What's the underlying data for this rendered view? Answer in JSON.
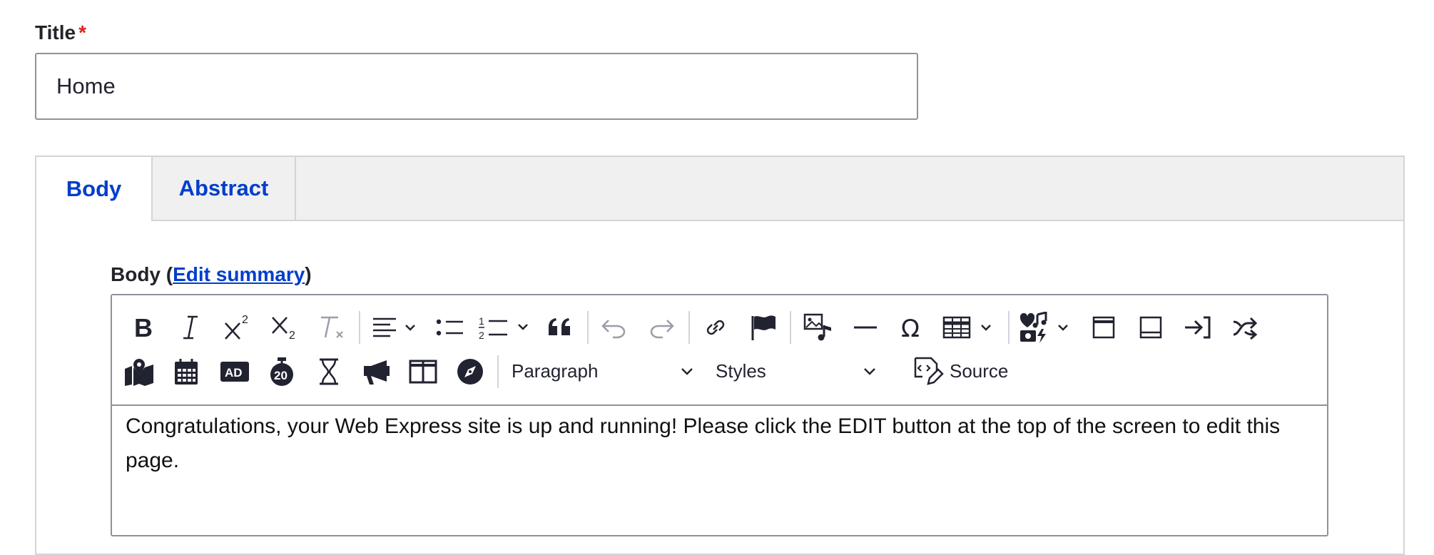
{
  "title_field": {
    "label": "Title",
    "required_marker": "*",
    "value": "Home"
  },
  "tabs": [
    {
      "label": "Body",
      "active": true
    },
    {
      "label": "Abstract",
      "active": false
    }
  ],
  "body_field": {
    "label_prefix": "Body (",
    "edit_summary_link": "Edit summary",
    "label_suffix": ")"
  },
  "toolbar": {
    "row1_icons": [
      "bold-icon",
      "italic-icon",
      "superscript-icon",
      "subscript-icon",
      "remove-format-icon",
      "text-align-icon",
      "bulleted-list-icon",
      "numbered-list-icon",
      "blockquote-icon",
      "undo-icon",
      "redo-icon",
      "link-icon",
      "flag-icon",
      "media-icon",
      "horizontal-line-icon",
      "special-characters-icon",
      "table-icon",
      "social-media-icon",
      "box-icon",
      "footer-icon",
      "login-icon",
      "share-icon"
    ],
    "row2_icons": [
      "map-icon",
      "calendar-icon",
      "ad-icon",
      "countdown-icon",
      "hourglass-icon",
      "megaphone-icon",
      "columns-icon",
      "compass-icon",
      "source-icon"
    ],
    "heading_dropdown": "Paragraph",
    "styles_dropdown": "Styles",
    "source_label": "Source"
  },
  "editor_content": "Congratulations, your Web Express site is up and running! Please click the EDIT button at the top of the screen to edit this page."
}
